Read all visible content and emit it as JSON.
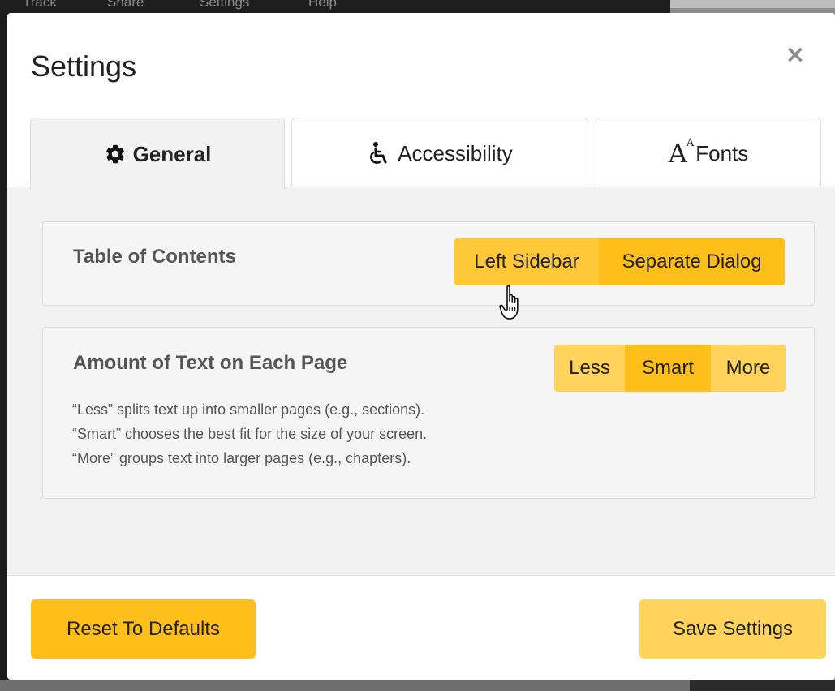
{
  "background": {
    "menu": [
      "Track",
      "Share",
      "Settings",
      "Help"
    ]
  },
  "modal": {
    "title": "Settings",
    "close_symbol": "×",
    "tabs": [
      {
        "label": "General",
        "icon": "gear-icon",
        "active": true
      },
      {
        "label": "Accessibility",
        "icon": "accessibility-icon",
        "active": false
      },
      {
        "label": "Fonts",
        "icon": "font-size-icon",
        "icon_text": "A",
        "icon_text_small": "A",
        "active": false
      }
    ],
    "toc": {
      "label": "Table of Contents",
      "options": [
        "Left Sidebar",
        "Separate Dialog"
      ],
      "selected": "Separate Dialog"
    },
    "amount": {
      "label": "Amount of Text on Each Page",
      "options": [
        "Less",
        "Smart",
        "More"
      ],
      "selected": "Smart",
      "descriptions": [
        "“Less” splits text up into smaller pages (e.g., sections).",
        "“Smart” chooses the best fit for the size of your screen.",
        "“More” groups text into larger pages (e.g., chapters)."
      ]
    },
    "footer": {
      "reset_label": "Reset To Defaults",
      "save_label": "Save Settings"
    }
  },
  "colors": {
    "accent": "#ffbf1a",
    "accent_light": "#ffd35c",
    "panel_bg": "#f2f2f2"
  }
}
